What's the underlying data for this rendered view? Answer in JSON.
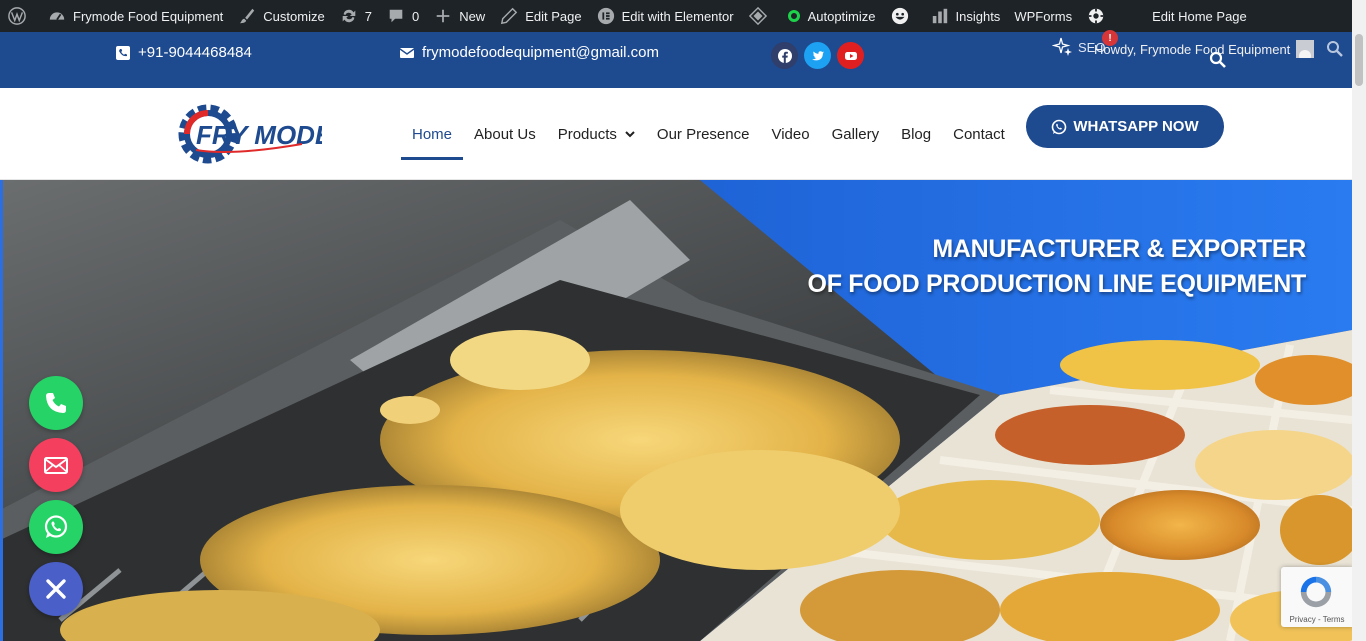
{
  "adminbar": {
    "site_name": "Frymode Food Equipment",
    "customize": "Customize",
    "updates_count": "7",
    "comments_count": "0",
    "new": "New",
    "edit_page": "Edit Page",
    "edit_elementor": "Edit with Elementor",
    "autoptimize": "Autoptimize",
    "insights": "Insights",
    "wpforms": "WPForms",
    "edit_home": "Edit Home Page",
    "seo": "SEO",
    "seo_badge": "!",
    "howdy": "Howdy, Frymode Food Equipment"
  },
  "topbar": {
    "phone": "+91-9044468484",
    "email": "frymodefoodequipment@gmail.com",
    "social": [
      "facebook-icon",
      "twitter-icon",
      "youtube-icon"
    ]
  },
  "logo": {
    "text": "FRY MODE"
  },
  "nav": {
    "items": [
      {
        "label": "Home"
      },
      {
        "label": "About Us"
      },
      {
        "label": "Products"
      },
      {
        "label": "Our Presence"
      },
      {
        "label": "Video"
      },
      {
        "label": "Gallery"
      },
      {
        "label": "Blog"
      },
      {
        "label": "Contact"
      }
    ],
    "cta": "WHATSAPP NOW"
  },
  "hero": {
    "line1": "MANUFACTURER & EXPORTER",
    "line2": "OF FOOD PRODUCTION LINE EQUIPMENT"
  },
  "recaptcha": {
    "label": "Privacy - Terms"
  },
  "colors": {
    "brand_blue": "#1e4a8f",
    "admin_bar": "#1d2327",
    "fab_phone": "#25d366",
    "fab_email": "#f43f5e",
    "fab_whatsapp": "#25d366",
    "fab_close": "#4a5fc8"
  }
}
